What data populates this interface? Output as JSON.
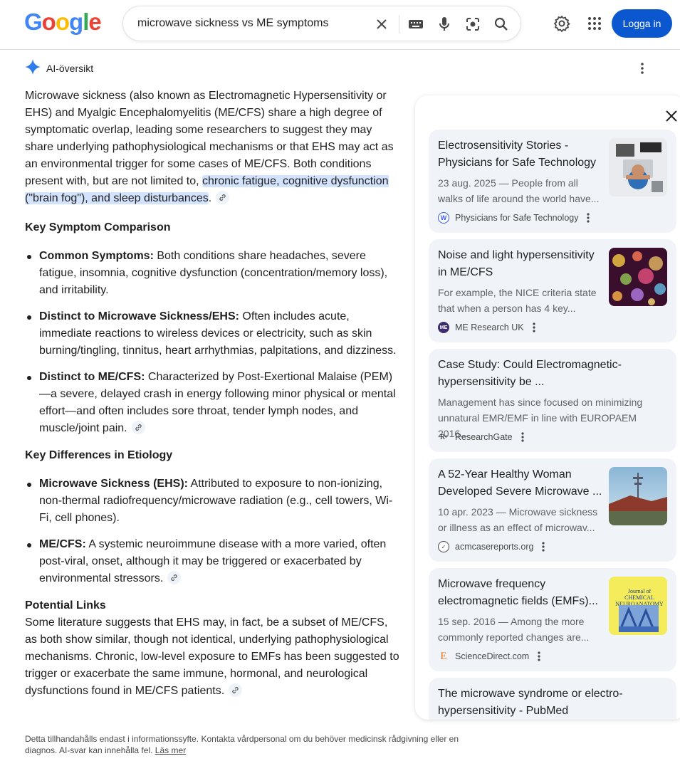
{
  "header": {
    "logo": "Google",
    "search_query": "microwave sickness vs ME symptoms",
    "login_label": "Logga in"
  },
  "ai_overview": {
    "label": "AI-översikt",
    "intro_before": "Microwave sickness (also known as Electromagnetic Hypersensitivity or EHS) and Myalgic Encephalomyelitis (ME/CFS) share a high degree of symptomatic overlap, leading some researchers to suggest they may share underlying pathophysiological mechanisms or that EHS may act as an environmental trigger for some cases of ME/CFS. Both conditions present with, but are not limited to, ",
    "intro_highlight": "chronic fatigue, cognitive dysfunction (\"brain fog\"), and sleep disturbances",
    "intro_after": ".",
    "section1": {
      "heading": "Key Symptom Comparison",
      "items": [
        {
          "term": "Common Symptoms:",
          "text": " Both conditions share headaches, severe fatigue, insomnia, cognitive dysfunction (concentration/memory loss), and irritability."
        },
        {
          "term": "Distinct to Microwave Sickness/EHS:",
          "text": " Often includes acute, immediate reactions to wireless devices or electricity, such as skin burning/tingling, tinnitus, heart arrhythmias, palpitations, and dizziness."
        },
        {
          "term": "Distinct to ME/CFS:",
          "text": " Characterized by Post-Exertional Malaise (PEM)—a severe, delayed crash in energy following minor physical or mental effort—and often includes sore throat, tender lymph nodes, and muscle/joint pain."
        }
      ]
    },
    "section2": {
      "heading": "Key Differences in Etiology",
      "items": [
        {
          "term": "Microwave Sickness (EHS):",
          "text": " Attributed to exposure to non-ionizing, non-thermal radiofrequency/microwave radiation (e.g., cell towers, Wi-Fi, cell phones)."
        },
        {
          "term": "ME/CFS:",
          "text": " A systemic neuroimmune disease with a more varied, often post-viral, onset, although it may be triggered or exacerbated by environmental stressors."
        }
      ]
    },
    "section3": {
      "heading": "Potential Links",
      "text": "Some literature suggests that EHS may, in fact, be a subset of ME/CFS, as both show similar, though not identical, underlying pathophysiological mechanisms. Chronic, low-level exposure to EMFs has been suggested to trigger or exacerbate the same immune, hormonal, and neurological dysfunctions found in ME/CFS patients."
    },
    "disclaimer": "Detta tillhandahålls endast i informationssyfte. Kontakta vårdpersonal om du behöver medicinsk rådgivning eller en diagnos. AI-svar kan innehålla fel. ",
    "disclaimer_link": "Läs mer"
  },
  "sources": [
    {
      "title": "Electrosensitivity Stories - Physicians for Safe Technology",
      "snippet": "23 aug. 2025 — People from all walks of life around the world have...",
      "source": "Physicians for Safe Technology",
      "favicon": "wordpress-icon"
    },
    {
      "title": "Noise and light hypersensitivity in ME/CFS",
      "snippet": "For example, the NICE criteria state that when a person has 4 key...",
      "source": "ME Research UK",
      "favicon": "me-research-icon"
    },
    {
      "title": "Case Study: Could Electromagnetic-hypersensitivity be ...",
      "snippet": "Management has since focused on minimizing unnatural EMR/EMF in line with EUROPAEM 2016...",
      "source": "ResearchGate",
      "favicon": "researchgate-icon"
    },
    {
      "title": "A 52-Year Healthy Woman Developed Severe Microwave ...",
      "snippet": "10 apr. 2023 — Microwave sickness or illness as an effect of microwav...",
      "source": "acmcasereports.org",
      "favicon": "acm-icon"
    },
    {
      "title": "Microwave frequency electromagnetic fields (EMFs)...",
      "snippet": "15 sep. 2016 — Among the more commonly reported changes are...",
      "source": "ScienceDirect.com",
      "favicon": "elsevier-icon",
      "thumb_text": "Journal of CHEMICAL NEUROANATOMY"
    },
    {
      "title": "The microwave syndrome or electro-hypersensitivity - PubMed",
      "snippet": "",
      "source": ""
    }
  ],
  "colors": {
    "accent": "#0b57d0",
    "highlight": "#d3e3fd",
    "card_bg": "#f0f4f9"
  }
}
